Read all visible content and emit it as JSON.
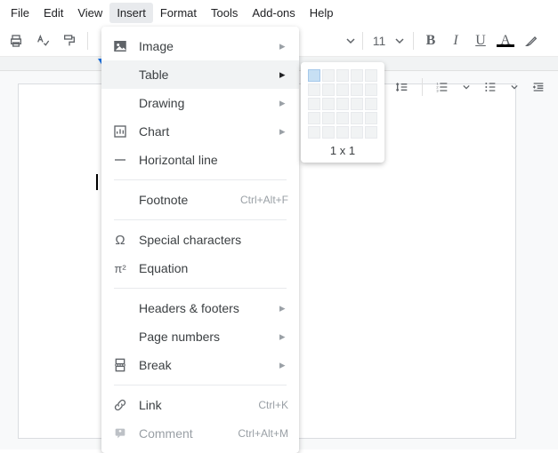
{
  "menubar": {
    "items": [
      {
        "label": "File"
      },
      {
        "label": "Edit"
      },
      {
        "label": "View"
      },
      {
        "label": "Insert"
      },
      {
        "label": "Format"
      },
      {
        "label": "Tools"
      },
      {
        "label": "Add-ons"
      },
      {
        "label": "Help"
      }
    ],
    "active_index": 3
  },
  "toolbar": {
    "font_size": "11"
  },
  "insert_menu": {
    "items": [
      {
        "label": "Image",
        "icon": "image-icon",
        "submenu": true
      },
      {
        "label": "Table",
        "icon": "table-icon",
        "submenu": true,
        "highlight": true
      },
      {
        "label": "Drawing",
        "icon": null,
        "submenu": true
      },
      {
        "label": "Chart",
        "icon": "chart-icon",
        "submenu": true
      },
      {
        "label": "Horizontal line",
        "icon": "horizontal-line-icon"
      },
      {
        "divider": true
      },
      {
        "label": "Footnote",
        "icon": null,
        "shortcut": "Ctrl+Alt+F"
      },
      {
        "divider": true
      },
      {
        "label": "Special characters",
        "icon": "omega-icon"
      },
      {
        "label": "Equation",
        "icon": "pi-squared-icon"
      },
      {
        "divider": true
      },
      {
        "label": "Headers & footers",
        "icon": null,
        "submenu": true
      },
      {
        "label": "Page numbers",
        "icon": null,
        "submenu": true
      },
      {
        "label": "Break",
        "icon": "page-break-icon",
        "submenu": true
      },
      {
        "divider": true
      },
      {
        "label": "Link",
        "icon": "link-icon",
        "shortcut": "Ctrl+K"
      },
      {
        "label": "Comment",
        "icon": "comment-icon",
        "shortcut": "Ctrl+Alt+M",
        "disabled": true
      }
    ]
  },
  "table_picker": {
    "label": "1 x 1",
    "rows": 5,
    "cols": 5,
    "selected_rows": 1,
    "selected_cols": 1
  }
}
